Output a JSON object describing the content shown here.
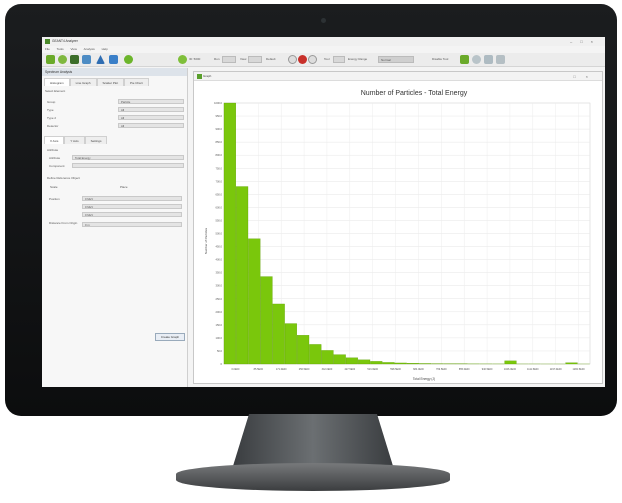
{
  "window": {
    "title": "GEANT4 Analyzer",
    "controls": [
      "–",
      "□",
      "×"
    ]
  },
  "menu": [
    "File",
    "Tools",
    "View",
    "Analysis",
    "Help"
  ],
  "toolbar": {
    "labels": [
      "ID: 5000",
      "Run",
      "View",
      "Default",
      "Tool",
      "Energy Range",
      "Normal",
      "Disable Tool"
    ]
  },
  "left_panel": {
    "title": "Spectrum Analysis",
    "tabs": [
      "Histogram",
      "Line Graph",
      "Scatter Plot",
      "Pie Chart"
    ],
    "section1": "Select Element",
    "fields": [
      {
        "label": "Group",
        "value": "Particle"
      },
      {
        "label": "Type",
        "value": "All"
      },
      {
        "label": "Type 2",
        "value": "All"
      },
      {
        "label": "Detector",
        "value": "All"
      }
    ],
    "subtabs": [
      "X Axis",
      "Y Axis",
      "Settings"
    ],
    "section2": "Attribute",
    "attribute": {
      "label": "Attribute",
      "value": "Total Energy"
    },
    "component": {
      "label": "Component",
      "value": ""
    },
    "section3": "Define Reference Object",
    "ref_options": [
      "Scale",
      "Place"
    ],
    "position": {
      "label": "Position",
      "x": "0 MeV",
      "y": "0 MeV",
      "z": "0 MeV"
    },
    "distance": {
      "label": "Distance From Origin",
      "value": "0 m"
    },
    "create_button": "Create Graph"
  },
  "chart_window": {
    "title": "Graph",
    "controls": [
      "□",
      "×"
    ]
  },
  "chart_data": {
    "type": "bar",
    "title": "Number of Particles - Total Energy",
    "xlabel": "Total Energy (J)",
    "ylabel": "Number of Particles",
    "ylim": [
      0,
      1000
    ],
    "y_ticks": [
      "0",
      "50.0",
      "100.0",
      "150.0",
      "200.0",
      "250.0",
      "300.0",
      "350.0",
      "400.0",
      "450.0",
      "500.0",
      "550.0",
      "600.0",
      "650.0",
      "700.0",
      "750.0",
      "800.0",
      "850.0",
      "900.0",
      "950.0",
      "1000.0"
    ],
    "x_ticks": [
      "0.0E00",
      "85.5E00",
      "171.0E00",
      "256.5E00",
      "342.0E00",
      "427.5E00",
      "513.0E00",
      "598.5E00",
      "684.0E00",
      "769.5E00",
      "855.0E00",
      "940.5E00",
      "1026.0E00",
      "1111.5E00",
      "1197.0E00",
      "1282.5E00"
    ],
    "values": [
      1000,
      680,
      480,
      335,
      230,
      155,
      110,
      75,
      52,
      36,
      24,
      16,
      10,
      6,
      4,
      3,
      2,
      1.5,
      1,
      0.8,
      0.5,
      0.4,
      0.3,
      12,
      0.2,
      0.2,
      0.1,
      0.1,
      5,
      0.1
    ],
    "grid": true,
    "bar_color": "#7ac70c"
  },
  "colors": {
    "accent": "#7ac70c",
    "frame": "#111315"
  }
}
